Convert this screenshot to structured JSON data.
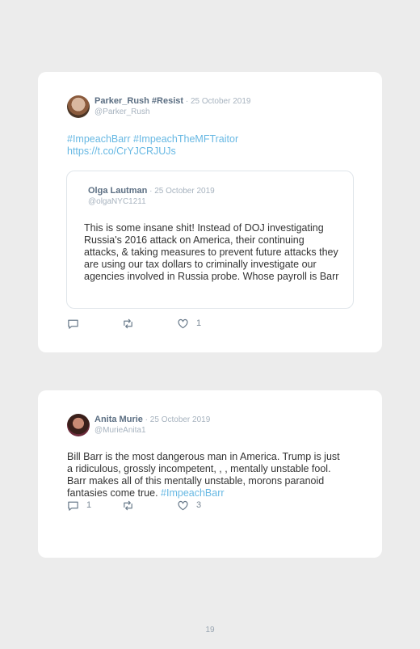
{
  "tweets": [
    {
      "author": "Parker_Rush #Resist",
      "date": " · 25 October 2019",
      "handle": "@Parker_Rush",
      "text_link_1": "#ImpeachBarr #ImpeachTheMFTraitor",
      "text_link_2": "https://t.co/CrYJCRJUJs",
      "quote": {
        "author": "Olga Lautman",
        "date": " · 25 October 2019",
        "handle": "@olgaNYC1211",
        "text": "This is some insane shit! Instead of DOJ investigating Russia's 2016 attack on America, their continuing attacks, & taking measures to prevent future attacks they are using our tax dollars to criminally investigate our agencies involved in Russia probe. Whose payroll is Barr"
      },
      "replies": "",
      "likes": "1"
    },
    {
      "author": "Anita Murie",
      "date": " · 25 October 2019",
      "handle": "@MurieAnita1",
      "text": "Bill Barr is the most dangerous man in America. Trump is just a ridiculous, grossly incompetent, , , mentally unstable fool. Barr makes all of this mentally unstable, morons paranoid fantasies come true. ",
      "hashtag": "#ImpeachBarr",
      "replies": "1",
      "likes": "3"
    }
  ],
  "icons": [
    "reply-icon",
    "retweet-icon",
    "like-icon"
  ],
  "colors": {
    "link": "#67b8e3",
    "name": "#5b6e82",
    "meta": "#a7b3bf",
    "background": "#ececec"
  },
  "page_number": "19"
}
